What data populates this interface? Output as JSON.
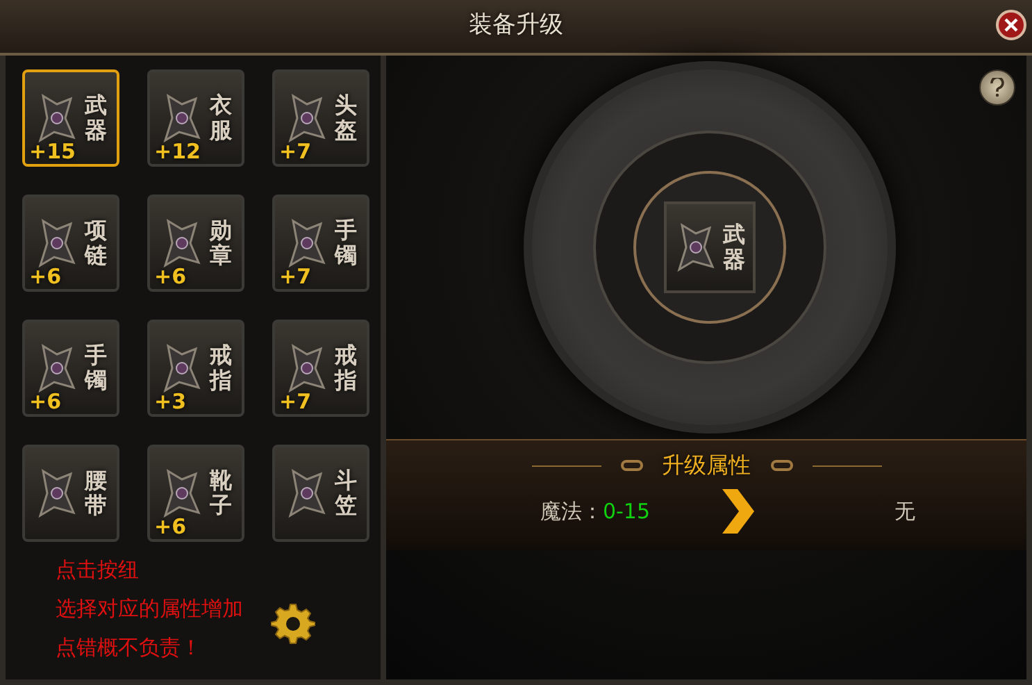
{
  "window": {
    "title": "装备升级"
  },
  "slots": [
    {
      "label": "武器",
      "level": "+15",
      "selected": true
    },
    {
      "label": "衣服",
      "level": "+12",
      "selected": false
    },
    {
      "label": "头盔",
      "level": "+7",
      "selected": false
    },
    {
      "label": "项链",
      "level": "+6",
      "selected": false
    },
    {
      "label": "勋章",
      "level": "+6",
      "selected": false
    },
    {
      "label": "手镯",
      "level": "+7",
      "selected": false
    },
    {
      "label": "手镯",
      "level": "+6",
      "selected": false
    },
    {
      "label": "戒指",
      "level": "+3",
      "selected": false
    },
    {
      "label": "戒指",
      "level": "+7",
      "selected": false
    },
    {
      "label": "腰带",
      "selected": false
    },
    {
      "label": "靴子",
      "level": "+6",
      "selected": false
    },
    {
      "label": "斗笠",
      "selected": false
    }
  ],
  "notes": [
    "点击按纽",
    "选择对应的属性增加",
    "点错概不负责！"
  ],
  "center_item": {
    "label": "武器"
  },
  "attributes": {
    "title": "升级属性",
    "name": "魔法：",
    "current": "0-15",
    "next": "无"
  }
}
